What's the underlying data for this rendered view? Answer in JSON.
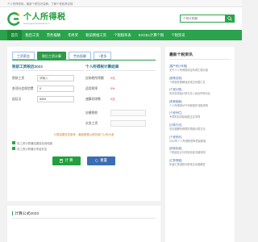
{
  "topbar": {
    "text": "个人所得税网，最新个税知识讲解，了解个税政策法规"
  },
  "header": {
    "logo_title": "个人所得税",
    "logo_sub": "www.gerensuodeshui.cn",
    "search_placeholder": "个税计算器",
    "brand_color": "#2aa34c"
  },
  "nav": {
    "items": [
      {
        "label": "首页"
      },
      {
        "label": "税后工资"
      },
      {
        "label": "劳务报酬"
      },
      {
        "label": "年终奖"
      },
      {
        "label": "税前倒推工资"
      },
      {
        "label": "个税税率表"
      },
      {
        "label": "EXCEL计算个税"
      },
      {
        "label": "个税资讯"
      }
    ]
  },
  "calc": {
    "tabs": [
      {
        "label": "工资薪金"
      },
      {
        "label": "税后工资计算"
      },
      {
        "label": "劳务报酬"
      },
      {
        "label": "+更多"
      }
    ],
    "left_title": "税前工资税后2023",
    "fields": [
      {
        "label": "税前工资",
        "placeholder": "请输入",
        "value": ""
      },
      {
        "label": "各项社会保险费",
        "placeholder": "",
        "value": "0"
      },
      {
        "label": "起征点",
        "placeholder": "",
        "value": "5000"
      }
    ],
    "right_title": "个人所得税计算结果",
    "results": [
      {
        "label": "应纳税所得额",
        "value": "0元"
      },
      {
        "label": "适用税率",
        "value": "0%"
      },
      {
        "label": "速算扣除数",
        "value": "0元"
      },
      {
        "label": "应缴税款",
        "value": ""
      },
      {
        "label": "实发工资",
        "value": ""
      }
    ],
    "note": "计算结果仅供参考，最新数据以税务部门公布为准",
    "checks": [
      {
        "label": "将工资计算器结果保存到电脑"
      },
      {
        "label": "将工资计算器分享给好友"
      }
    ],
    "buttons": {
      "calc": "计 算",
      "reset": "重置"
    }
  },
  "formula": {
    "title": "计算公式2023"
  },
  "sidebar": {
    "title": "最新个税资讯",
    "news": [
      {
        "tag": "[国产统计年报]",
        "desc": "关于个人所得税综合所得汇算清缴"
      },
      {
        "tag": "[政策法规]",
        "desc": "个税新政策解读及常见问题汇总"
      },
      {
        "tag": "[个税计算]",
        "desc": "年终奖单独计税与并入综合所得对比"
      },
      {
        "tag": "[申报指南]",
        "desc": "个人所得税APP申报操作流程说明"
      },
      {
        "tag": "[个税专栏]",
        "desc": "专项附加扣除填报注意事项"
      },
      {
        "tag": "[计算方法]",
        "desc": "劳务报酬所得预扣预缴计算方法"
      },
      {
        "tag": "[个税资讯]",
        "desc": "2023年个人所得税税率表最新版"
      },
      {
        "tag": "[扣除标准]",
        "desc": "个税起征点与扣除标准详细说明"
      },
      {
        "tag": "[汇算清缴]",
        "desc": "年度汇算退税补税常见问题解答"
      }
    ]
  }
}
